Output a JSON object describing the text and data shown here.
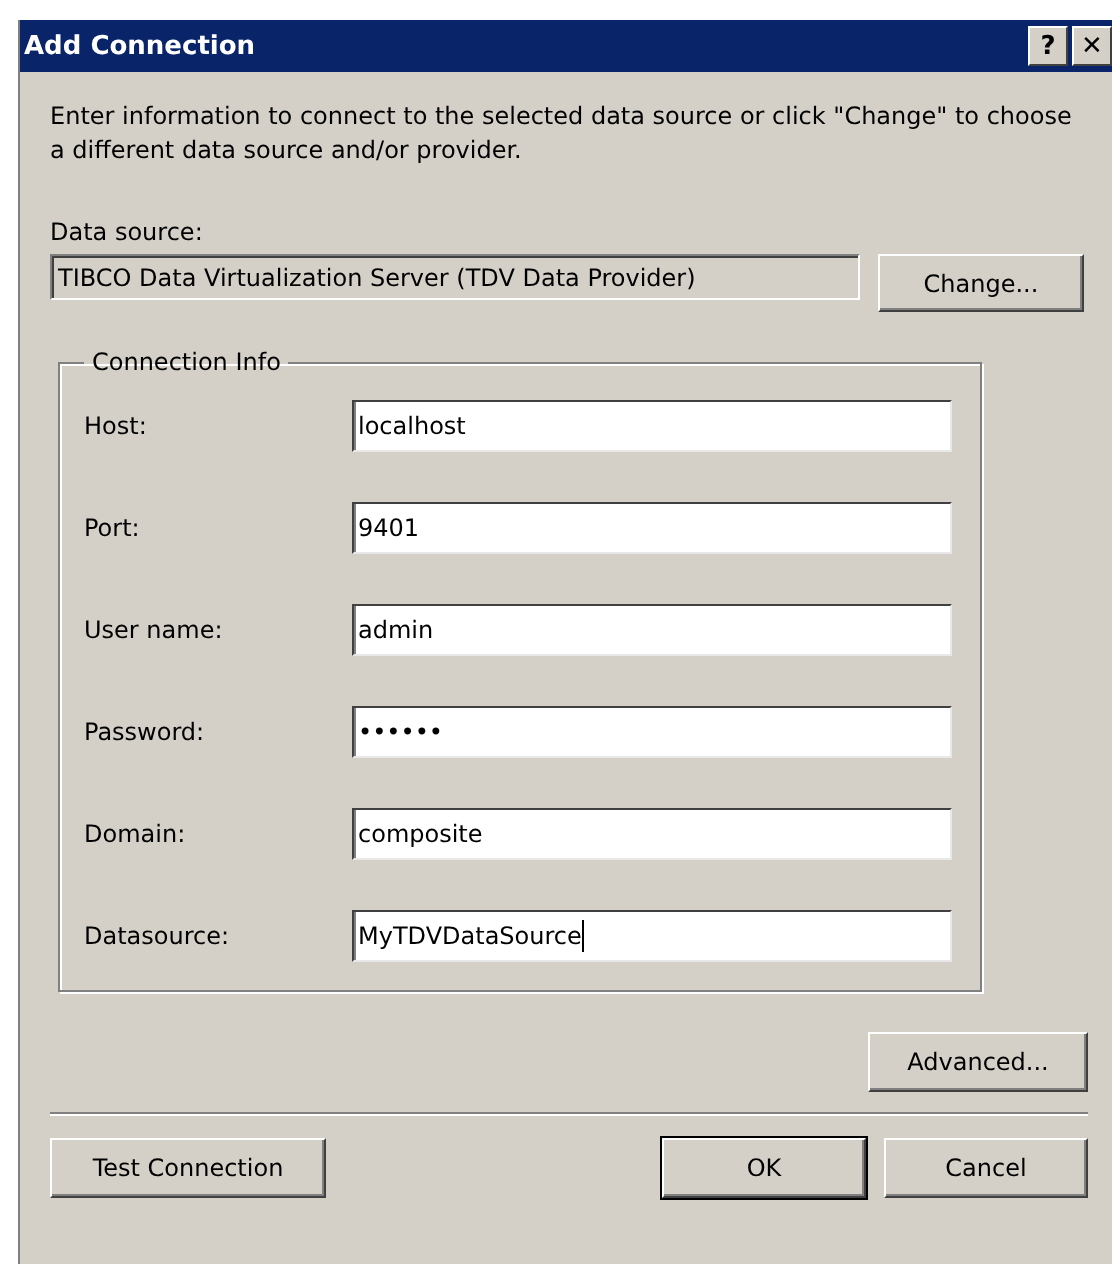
{
  "window": {
    "title": "Add Connection",
    "title_buttons": [
      "?",
      "✕"
    ]
  },
  "intro": "Enter information to connect to the selected data source or click \"Change\" to choose a different data source and/or provider.",
  "data_source": {
    "label": "Data source:",
    "value": "TIBCO Data Virtualization Server (TDV Data Provider)",
    "button": "Change..."
  },
  "connection_info": {
    "title": "Connection Info",
    "fields": [
      {
        "label": "Host:",
        "value": "localhost",
        "focused": false
      },
      {
        "label": "Port:",
        "value": "9401",
        "focused": false
      },
      {
        "label": "User name:",
        "value": "admin",
        "focused": false
      },
      {
        "label": "Password:",
        "value": "••••••",
        "focused": false
      },
      {
        "label": "Domain:",
        "value": "composite",
        "focused": false
      },
      {
        "label": "Datasource:",
        "value": "MyTDVDataSource",
        "focused": true
      }
    ]
  },
  "advanced_button": "Advanced...",
  "buttons": [
    {
      "label": "Test Connection",
      "default": false
    },
    {
      "label": "OK",
      "default": true
    },
    {
      "label": "Cancel",
      "default": false
    }
  ]
}
